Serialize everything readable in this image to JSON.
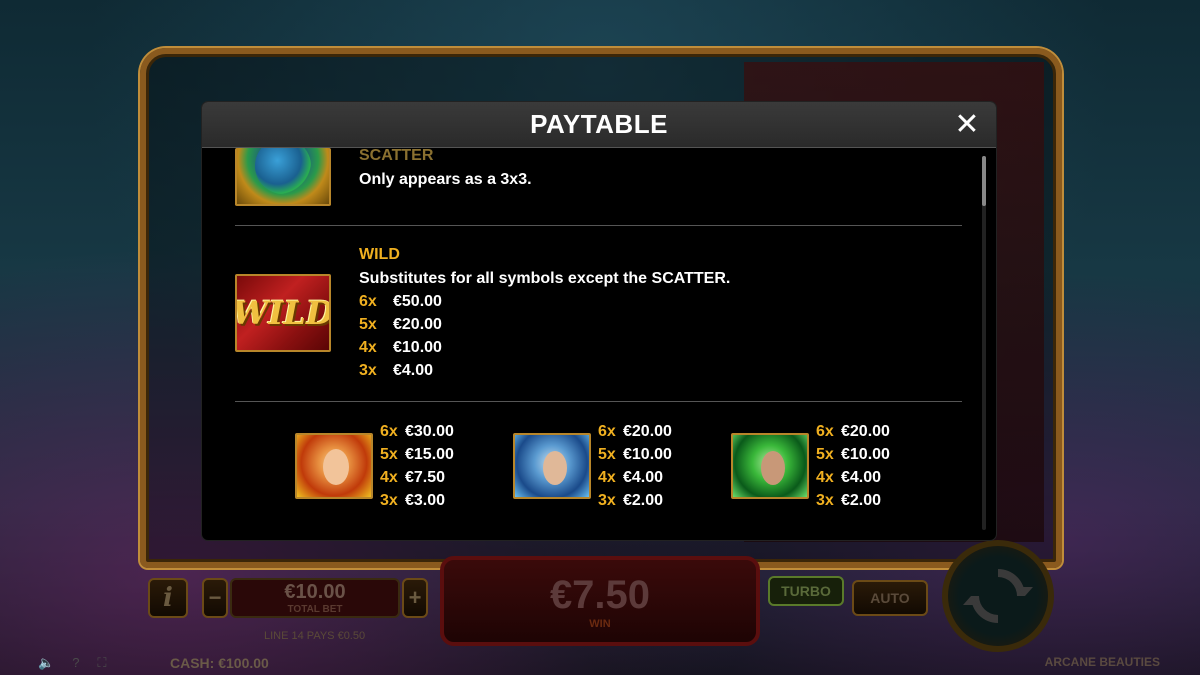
{
  "modal": {
    "title": "PAYTABLE",
    "close_label": "✕"
  },
  "scatter": {
    "title": "SCATTER",
    "description": "Only appears as a 3x3.",
    "icon": "scatter-orb-icon"
  },
  "wild": {
    "title": "WILD",
    "description": "Substitutes for all symbols except the SCATTER.",
    "image_text": "WILD",
    "pays": [
      {
        "count": "6x",
        "amount": "€50.00"
      },
      {
        "count": "5x",
        "amount": "€20.00"
      },
      {
        "count": "4x",
        "amount": "€10.00"
      },
      {
        "count": "3x",
        "amount": "€4.00"
      }
    ]
  },
  "beauties": [
    {
      "name": "fire-beauty",
      "color": "#e8701a",
      "pays": [
        {
          "count": "6x",
          "amount": "€30.00"
        },
        {
          "count": "5x",
          "amount": "€15.00"
        },
        {
          "count": "4x",
          "amount": "€7.50"
        },
        {
          "count": "3x",
          "amount": "€3.00"
        }
      ]
    },
    {
      "name": "ice-beauty",
      "color": "#3a9ad8",
      "pays": [
        {
          "count": "6x",
          "amount": "€20.00"
        },
        {
          "count": "5x",
          "amount": "€10.00"
        },
        {
          "count": "4x",
          "amount": "€4.00"
        },
        {
          "count": "3x",
          "amount": "€2.00"
        }
      ]
    },
    {
      "name": "nature-beauty",
      "color": "#3ab83a",
      "pays": [
        {
          "count": "6x",
          "amount": "€20.00"
        },
        {
          "count": "5x",
          "amount": "€10.00"
        },
        {
          "count": "4x",
          "amount": "€4.00"
        },
        {
          "count": "3x",
          "amount": "€2.00"
        }
      ]
    }
  ],
  "game_ui": {
    "info_label": "i",
    "minus_label": "−",
    "plus_label": "+",
    "total_bet_value": "€10.00",
    "total_bet_label": "TOTAL BET",
    "win_value": "€7.50",
    "win_label": "WIN",
    "turbo_label": "TURBO",
    "auto_label": "AUTO",
    "line_pays": "LINE 14 PAYS €0.50",
    "cash": "CASH: €100.00",
    "game_title": "ARCANE BEAUTIES",
    "sys_icons": [
      "speaker-icon",
      "help-icon",
      "fullscreen-icon"
    ]
  }
}
